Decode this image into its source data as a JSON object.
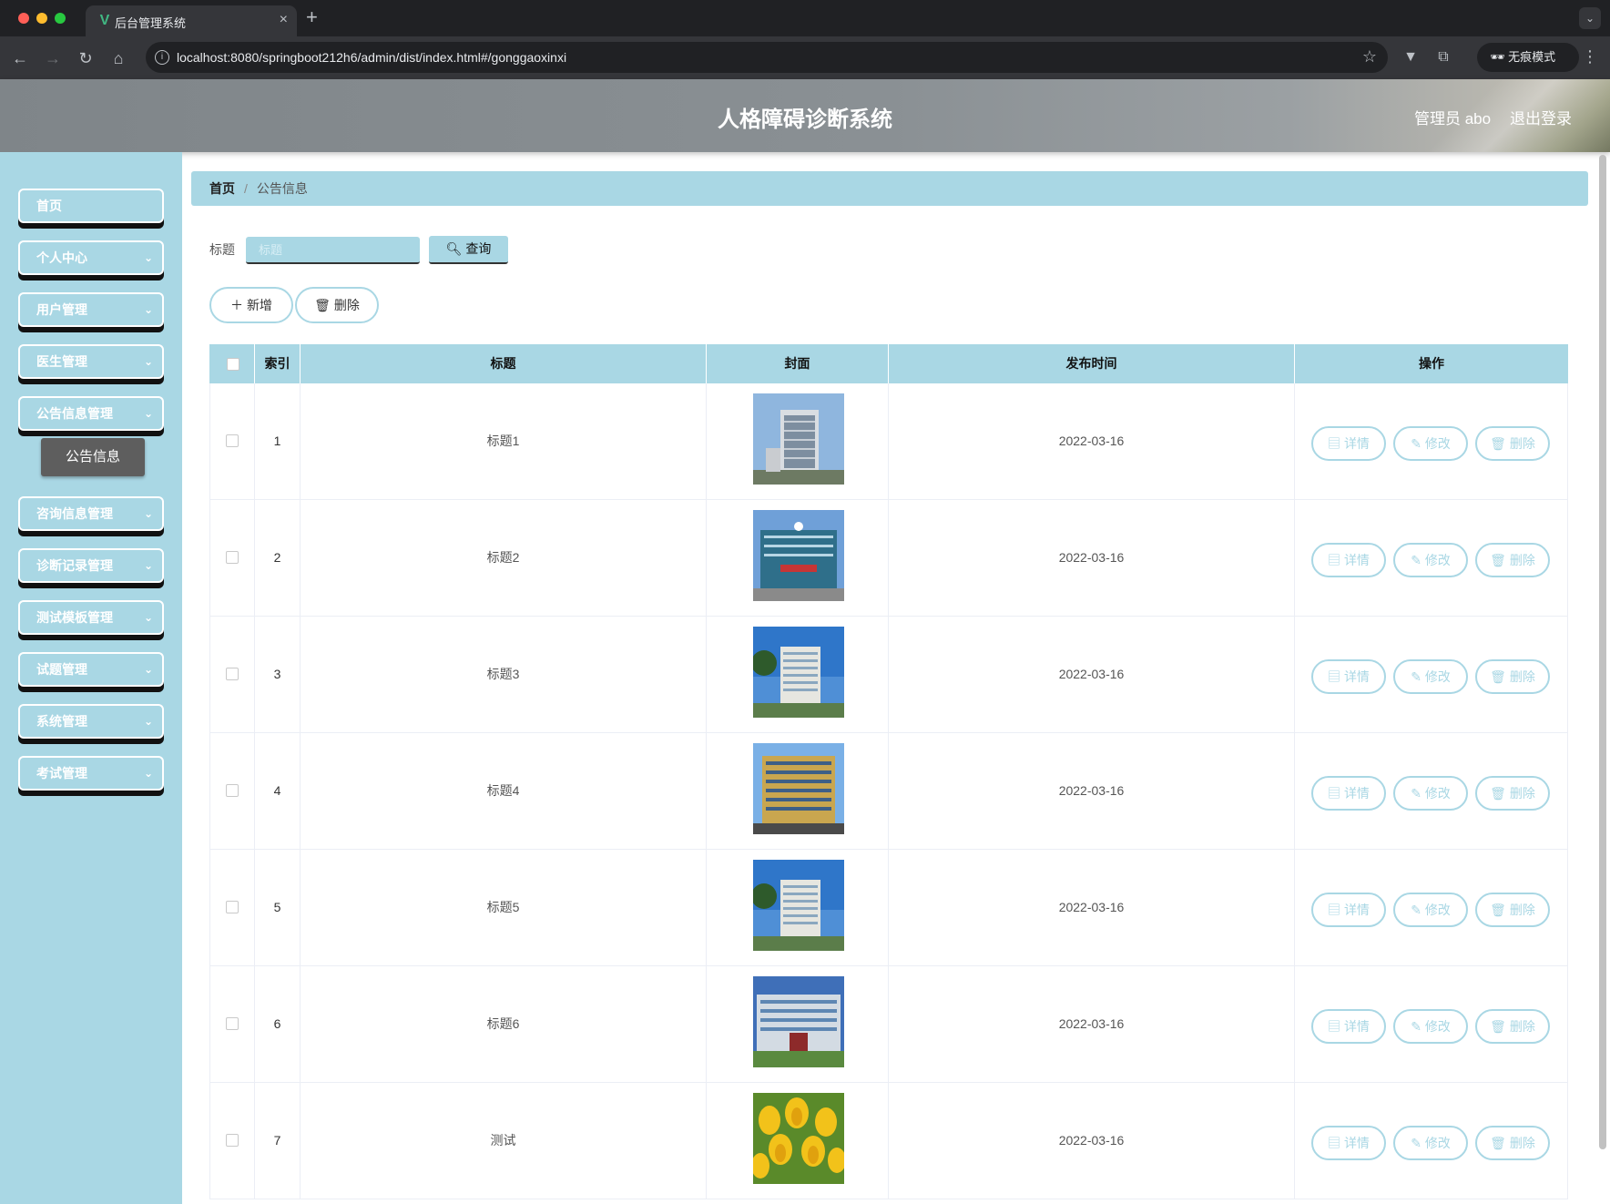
{
  "browser": {
    "tab_title": "后台管理系统",
    "url": "localhost:8080/springboot212h6/admin/dist/index.html#/gonggaoxinxi",
    "incognito_label": "无痕模式"
  },
  "header": {
    "title": "人格障碍诊断系统",
    "user_label": "管理员 abo",
    "logout_label": "退出登录"
  },
  "sidebar": {
    "items": [
      {
        "label": "首页",
        "has_children": false
      },
      {
        "label": "个人中心",
        "has_children": true
      },
      {
        "label": "用户管理",
        "has_children": true
      },
      {
        "label": "医生管理",
        "has_children": true
      },
      {
        "label": "公告信息管理",
        "has_children": true
      },
      {
        "label": "咨询信息管理",
        "has_children": true
      },
      {
        "label": "诊断记录管理",
        "has_children": true
      },
      {
        "label": "测试模板管理",
        "has_children": true
      },
      {
        "label": "试题管理",
        "has_children": true
      },
      {
        "label": "系统管理",
        "has_children": true
      },
      {
        "label": "考试管理",
        "has_children": true
      }
    ],
    "active_sub_item": "公告信息"
  },
  "breadcrumb": {
    "home": "首页",
    "current": "公告信息"
  },
  "search": {
    "label": "标题",
    "placeholder": "标题",
    "value": "",
    "button_label": "查询"
  },
  "toolbar": {
    "add_label": "新增",
    "delete_label": "删除"
  },
  "table": {
    "columns": {
      "index": "索引",
      "title": "标题",
      "cover": "封面",
      "publish_time": "发布时间",
      "actions": "操作"
    },
    "action_labels": {
      "detail": "详情",
      "edit": "修改",
      "delete": "删除"
    },
    "rows": [
      {
        "index": "1",
        "title": "标题1",
        "cover": "hospital-building-photo",
        "publish_time": "2022-03-16"
      },
      {
        "index": "2",
        "title": "标题2",
        "cover": "hospital-entrance-photo",
        "publish_time": "2022-03-16"
      },
      {
        "index": "3",
        "title": "标题3",
        "cover": "hospital-rendering-photo",
        "publish_time": "2022-03-16"
      },
      {
        "index": "4",
        "title": "标题4",
        "cover": "hospital-tower-photo",
        "publish_time": "2022-03-16"
      },
      {
        "index": "5",
        "title": "标题5",
        "cover": "hospital-rendering-photo",
        "publish_time": "2022-03-16"
      },
      {
        "index": "6",
        "title": "标题6",
        "cover": "hospital-front-photo",
        "publish_time": "2022-03-16"
      },
      {
        "index": "7",
        "title": "测试",
        "cover": "tulips-photo",
        "publish_time": "2022-03-16"
      }
    ]
  },
  "colors": {
    "accent": "#a9d7e4",
    "sub_active": "#5e5e5e"
  }
}
